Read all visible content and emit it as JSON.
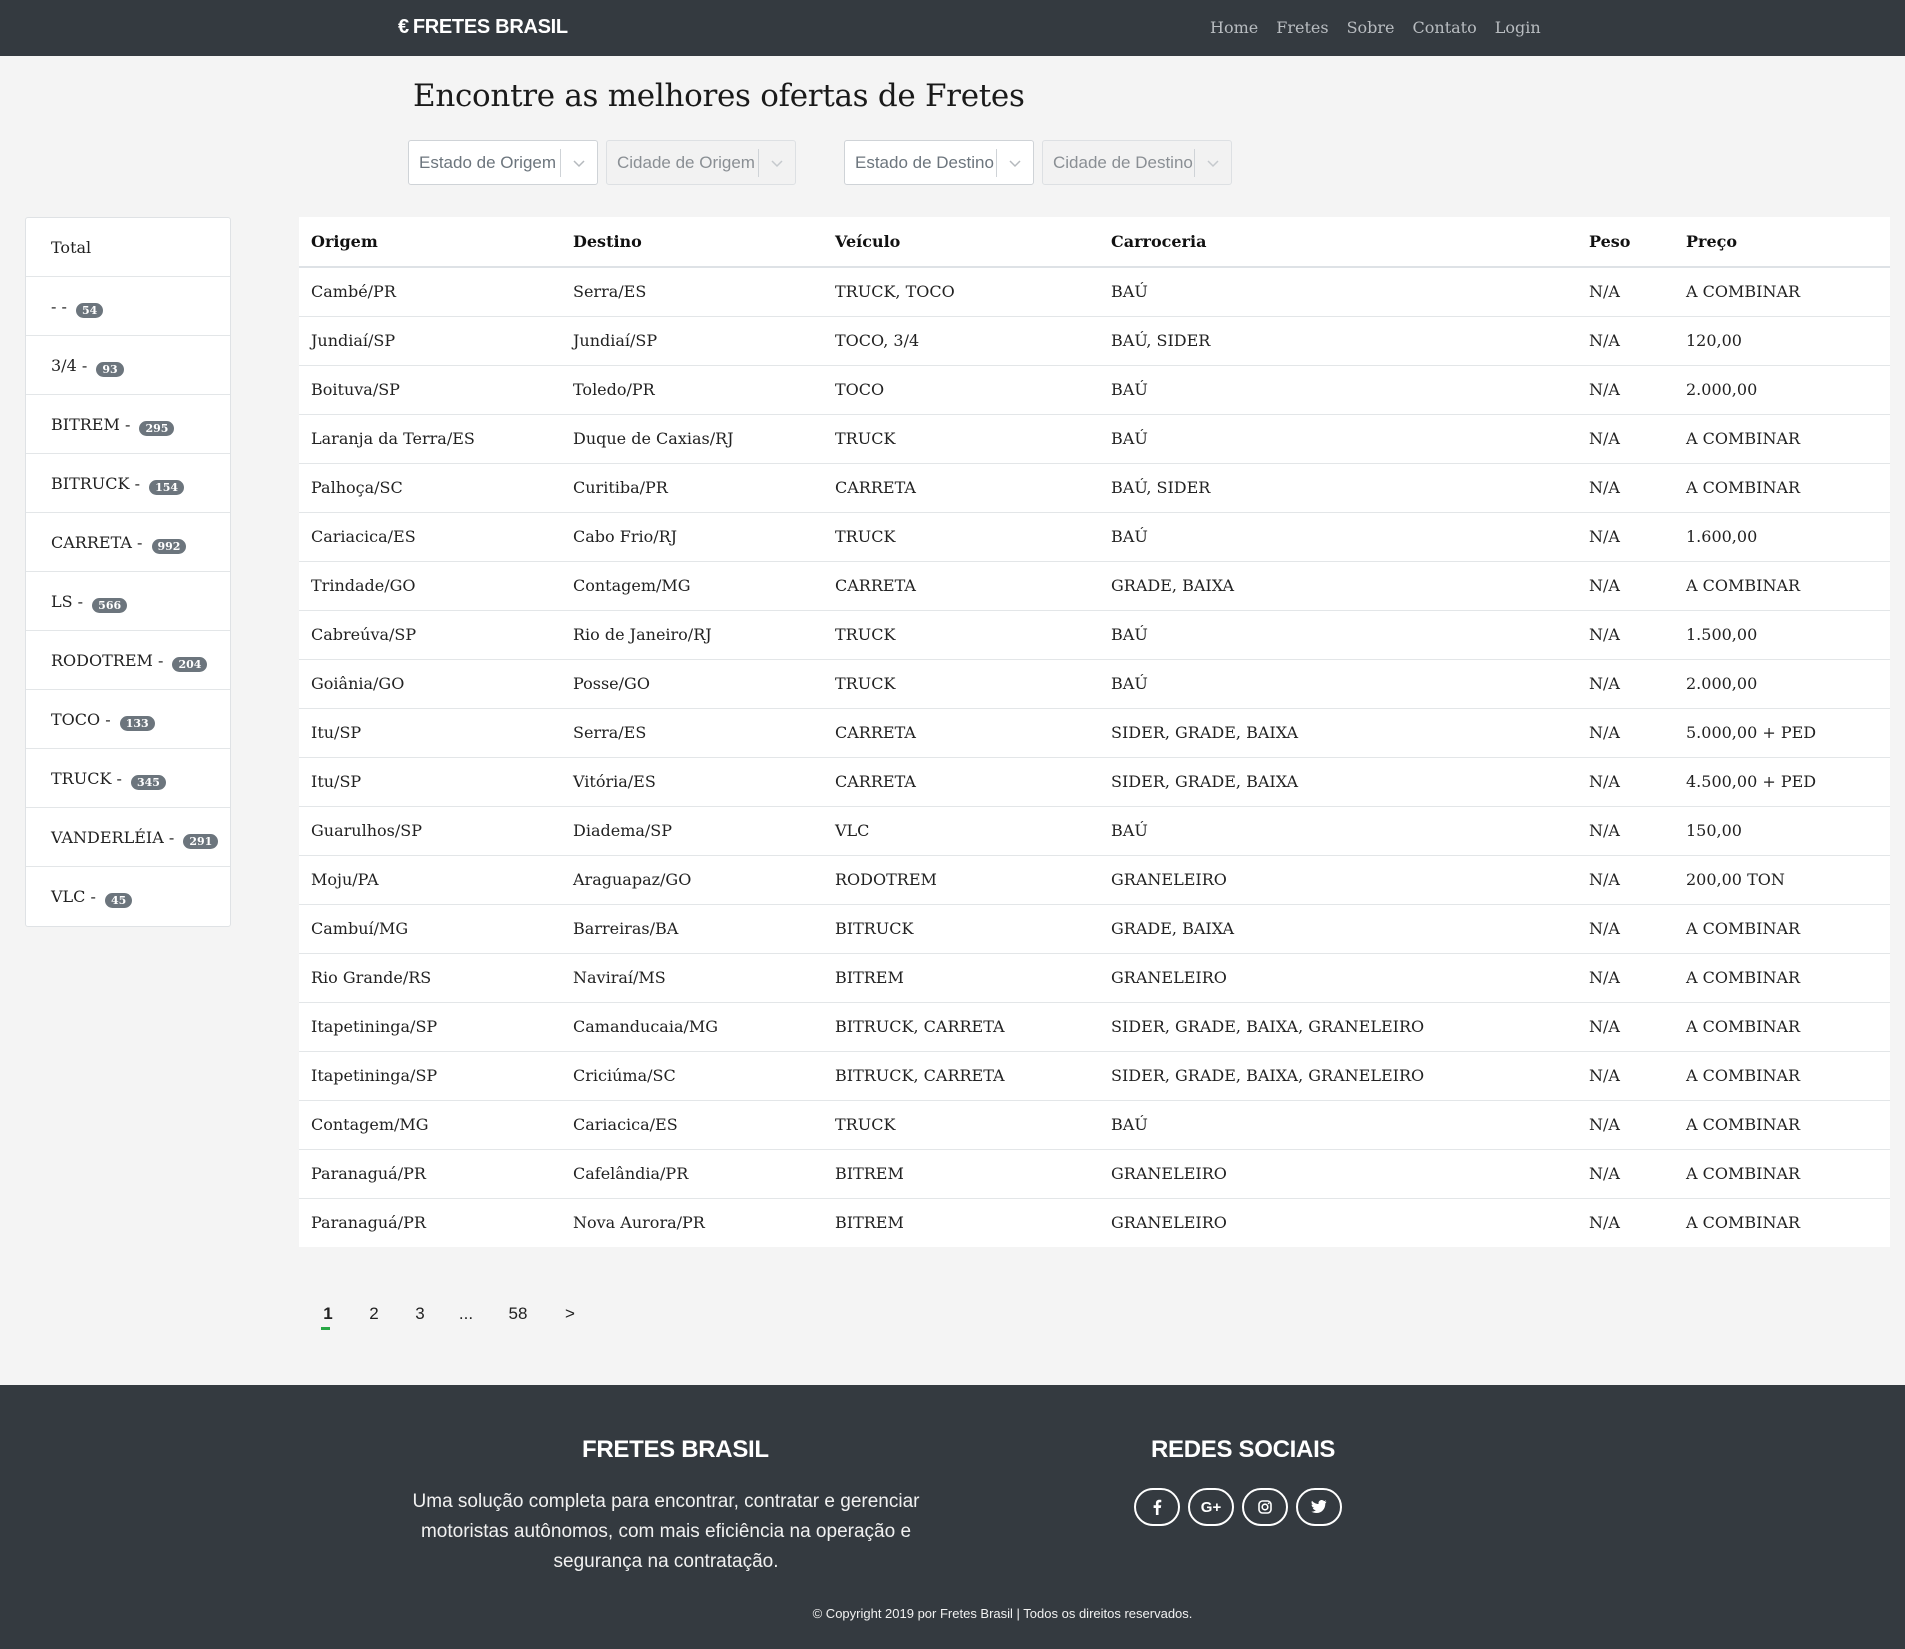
{
  "navbar": {
    "brand": "FRETES BRASIL",
    "links": [
      "Home",
      "Fretes",
      "Sobre",
      "Contato",
      "Login"
    ]
  },
  "main": {
    "title": "Encontre as melhores ofertas de Fretes"
  },
  "filters": {
    "estado_origem": "Estado de Origem",
    "cidade_origem": "Cidade de Origem",
    "estado_destino": "Estado de Destino",
    "cidade_destino": "Cidade de Destino"
  },
  "sidebar": {
    "total_label": "Total",
    "items": [
      {
        "label": "-",
        "count": "54"
      },
      {
        "label": "3/4",
        "count": "93"
      },
      {
        "label": "BITREM",
        "count": "295"
      },
      {
        "label": "BITRUCK",
        "count": "154"
      },
      {
        "label": "CARRETA",
        "count": "992"
      },
      {
        "label": "LS",
        "count": "566"
      },
      {
        "label": "RODOTREM",
        "count": "204"
      },
      {
        "label": "TOCO",
        "count": "133"
      },
      {
        "label": "TRUCK",
        "count": "345"
      },
      {
        "label": "VANDERLÉIA",
        "count": "291"
      },
      {
        "label": "VLC",
        "count": "45"
      }
    ]
  },
  "table": {
    "headers": [
      "Origem",
      "Destino",
      "Veículo",
      "Carroceria",
      "Peso",
      "Preço"
    ],
    "rows": [
      [
        "Cambé/PR",
        "Serra/ES",
        "TRUCK, TOCO",
        "BAÚ",
        "N/A",
        "A COMBINAR"
      ],
      [
        "Jundiaí/SP",
        "Jundiaí/SP",
        "TOCO, 3/4",
        "BAÚ, SIDER",
        "N/A",
        "120,00"
      ],
      [
        "Boituva/SP",
        "Toledo/PR",
        "TOCO",
        "BAÚ",
        "N/A",
        "2.000,00"
      ],
      [
        "Laranja da Terra/ES",
        "Duque de Caxias/RJ",
        "TRUCK",
        "BAÚ",
        "N/A",
        "A COMBINAR"
      ],
      [
        "Palhoça/SC",
        "Curitiba/PR",
        "CARRETA",
        "BAÚ, SIDER",
        "N/A",
        "A COMBINAR"
      ],
      [
        "Cariacica/ES",
        "Cabo Frio/RJ",
        "TRUCK",
        "BAÚ",
        "N/A",
        "1.600,00"
      ],
      [
        "Trindade/GO",
        "Contagem/MG",
        "CARRETA",
        "GRADE, BAIXA",
        "N/A",
        "A COMBINAR"
      ],
      [
        "Cabreúva/SP",
        "Rio de Janeiro/RJ",
        "TRUCK",
        "BAÚ",
        "N/A",
        "1.500,00"
      ],
      [
        "Goiânia/GO",
        "Posse/GO",
        "TRUCK",
        "BAÚ",
        "N/A",
        "2.000,00"
      ],
      [
        "Itu/SP",
        "Serra/ES",
        "CARRETA",
        "SIDER, GRADE, BAIXA",
        "N/A",
        "5.000,00 + PED"
      ],
      [
        "Itu/SP",
        "Vitória/ES",
        "CARRETA",
        "SIDER, GRADE, BAIXA",
        "N/A",
        "4.500,00 + PED"
      ],
      [
        "Guarulhos/SP",
        "Diadema/SP",
        "VLC",
        "BAÚ",
        "N/A",
        "150,00"
      ],
      [
        "Moju/PA",
        "Araguapaz/GO",
        "RODOTREM",
        "GRANELEIRO",
        "N/A",
        "200,00 TON"
      ],
      [
        "Cambuí/MG",
        "Barreiras/BA",
        "BITRUCK",
        "GRADE, BAIXA",
        "N/A",
        "A COMBINAR"
      ],
      [
        "Rio Grande/RS",
        "Naviraí/MS",
        "BITREM",
        "GRANELEIRO",
        "N/A",
        "A COMBINAR"
      ],
      [
        "Itapetininga/SP",
        "Camanducaia/MG",
        "BITRUCK, CARRETA",
        "SIDER, GRADE, BAIXA, GRANELEIRO",
        "N/A",
        "A COMBINAR"
      ],
      [
        "Itapetininga/SP",
        "Criciúma/SC",
        "BITRUCK, CARRETA",
        "SIDER, GRADE, BAIXA, GRANELEIRO",
        "N/A",
        "A COMBINAR"
      ],
      [
        "Contagem/MG",
        "Cariacica/ES",
        "TRUCK",
        "BAÚ",
        "N/A",
        "A COMBINAR"
      ],
      [
        "Paranaguá/PR",
        "Cafelândia/PR",
        "BITREM",
        "GRANELEIRO",
        "N/A",
        "A COMBINAR"
      ],
      [
        "Paranaguá/PR",
        "Nova Aurora/PR",
        "BITREM",
        "GRANELEIRO",
        "N/A",
        "A COMBINAR"
      ]
    ]
  },
  "pagination": {
    "pages": [
      "1",
      "2",
      "3",
      "...",
      "58",
      ">"
    ],
    "active": "1"
  },
  "footer": {
    "brand_title": "FRETES BRASIL",
    "description": "Uma solução completa para encontrar, contratar e gerenciar motoristas autônomos, com mais eficiência na operação e segurança na contratação.",
    "social_title": "REDES SOCIAIS",
    "social_icons": [
      "facebook-icon",
      "google-plus-icon",
      "instagram-icon",
      "twitter-icon"
    ],
    "copyright": "© Copyright 2019 por Fretes Brasil | Todos os direitos reservados."
  }
}
